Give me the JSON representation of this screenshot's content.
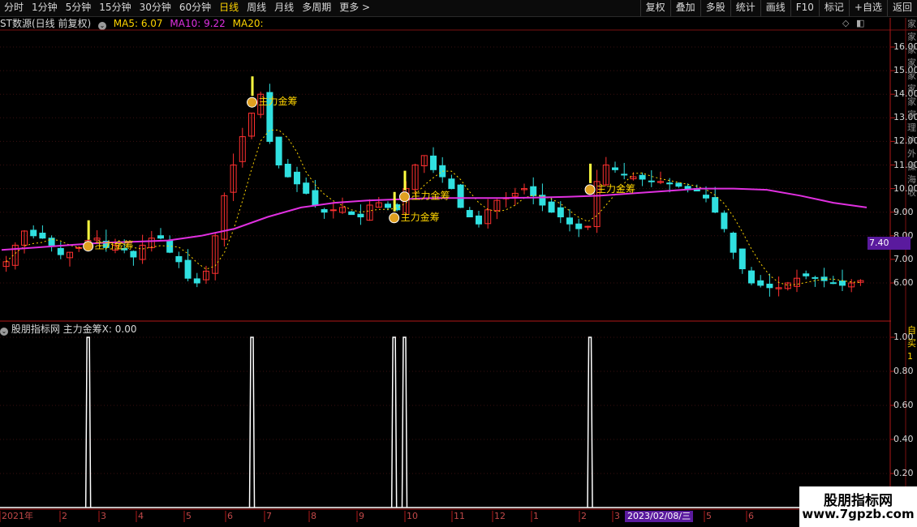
{
  "toolbar": {
    "tabs": [
      "分时",
      "1分钟",
      "5分钟",
      "15分钟",
      "30分钟",
      "60分钟",
      "日线",
      "周线",
      "月线",
      "多周期",
      "更多 >"
    ],
    "active_tab": "日线",
    "right_buttons": [
      "复权",
      "叠加",
      "多股",
      "统计",
      "画线",
      "F10",
      "标记",
      "+自选",
      "返回"
    ]
  },
  "main_panel": {
    "stock_title": "ST数源",
    "period_desc": "(日线 前复权)",
    "ma5": "MA5: 6.07",
    "ma10": "MA10: 9.22",
    "ma20": "MA20:",
    "ma5_color": "#ffd400",
    "ma10_color": "#e030e0",
    "ma20_color": "#ffd400",
    "price_labels": [
      "16.00",
      "15.00",
      "14.00",
      "13.00",
      "12.00",
      "11.00",
      "10.00",
      "9.00",
      "8.00",
      "7.00",
      "6.00"
    ],
    "last_price": "7.40",
    "signal_label": "主力金筹",
    "right_column_text": "家家家家家家家家理沪外操海收"
  },
  "sub_panel": {
    "title": "股朋指标网",
    "indicator": "主力金筹X: 0.00",
    "scale_labels": [
      "1.00",
      "0.80",
      "0.60",
      "0.40",
      "0.20"
    ],
    "right_column_text": "自买1"
  },
  "x_axis": {
    "labels": [
      "2021年",
      "2",
      "3",
      "4",
      "5",
      "6",
      "7",
      "8",
      "9",
      "10",
      "11",
      "12",
      "1",
      "2",
      "3",
      "4",
      "5",
      "6"
    ],
    "cursor_date": "2023/02/08/三"
  },
  "watermark": {
    "line1": "股朋指标网",
    "line2": "www.7gpzb.com"
  },
  "chart_data": {
    "type": "candlestick",
    "y_range": [
      5.0,
      17.0
    ],
    "ma_long_series": [
      7.4,
      7.5,
      7.6,
      7.7,
      7.75,
      7.8,
      8.0,
      8.3,
      8.8,
      9.2,
      9.4,
      9.5,
      9.55,
      9.6,
      9.6,
      9.6,
      9.62,
      9.65,
      9.7,
      9.8,
      9.9,
      10.0,
      10.0,
      9.95,
      9.7,
      9.4,
      9.2
    ],
    "close_series": [
      6.9,
      7.6,
      8.2,
      8.0,
      7.9,
      7.6,
      7.2,
      7.3,
      7.5,
      7.8,
      7.9,
      7.5,
      7.6,
      7.4,
      7.1,
      7.6,
      7.9,
      7.9,
      7.3,
      6.9,
      6.2,
      6.0,
      6.5,
      8.0,
      9.7,
      11.0,
      12.2,
      13.2,
      14.0,
      12.0,
      11.0,
      10.5,
      10.2,
      9.8,
      9.3,
      9.0,
      9.1,
      9.2,
      8.9,
      8.8,
      9.3,
      9.4,
      9.2,
      9.1,
      10.0,
      11.0,
      11.4,
      10.8,
      10.5,
      10.0,
      9.2,
      8.8,
      8.5,
      9.1,
      9.5,
      9.6,
      9.8,
      10.0,
      9.7,
      9.3,
      9.0,
      8.8,
      8.5,
      8.3,
      8.4,
      10.3,
      11.0,
      10.8,
      10.6,
      10.5,
      10.4,
      10.3,
      10.3,
      10.2,
      10.1,
      10.0,
      9.9,
      9.6,
      9.0,
      8.3,
      7.3,
      6.6,
      6.0,
      5.9,
      5.8,
      5.8,
      6.0,
      6.2,
      6.3,
      6.2,
      6.1,
      6.0,
      5.9,
      6.0,
      6.1
    ],
    "signals_x_fraction": [
      0.098,
      0.287,
      0.451,
      0.463,
      0.677
    ],
    "signal_value": 1.0
  }
}
